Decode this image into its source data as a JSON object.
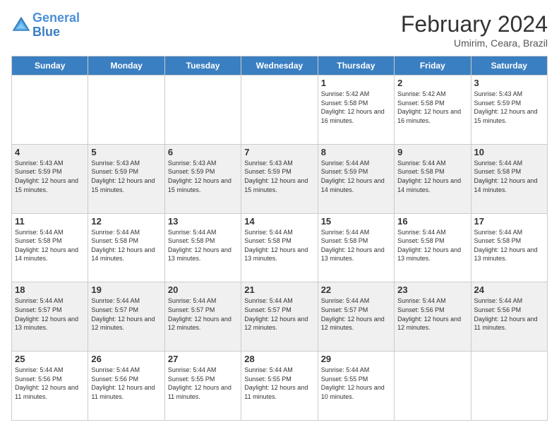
{
  "header": {
    "logo_line1": "General",
    "logo_line2": "Blue",
    "month_title": "February 2024",
    "location": "Umirim, Ceara, Brazil"
  },
  "days_of_week": [
    "Sunday",
    "Monday",
    "Tuesday",
    "Wednesday",
    "Thursday",
    "Friday",
    "Saturday"
  ],
  "weeks": [
    [
      {
        "day": "",
        "info": ""
      },
      {
        "day": "",
        "info": ""
      },
      {
        "day": "",
        "info": ""
      },
      {
        "day": "",
        "info": ""
      },
      {
        "day": "1",
        "info": "Sunrise: 5:42 AM\nSunset: 5:58 PM\nDaylight: 12 hours and 16 minutes."
      },
      {
        "day": "2",
        "info": "Sunrise: 5:42 AM\nSunset: 5:58 PM\nDaylight: 12 hours and 16 minutes."
      },
      {
        "day": "3",
        "info": "Sunrise: 5:43 AM\nSunset: 5:59 PM\nDaylight: 12 hours and 15 minutes."
      }
    ],
    [
      {
        "day": "4",
        "info": "Sunrise: 5:43 AM\nSunset: 5:59 PM\nDaylight: 12 hours and 15 minutes."
      },
      {
        "day": "5",
        "info": "Sunrise: 5:43 AM\nSunset: 5:59 PM\nDaylight: 12 hours and 15 minutes."
      },
      {
        "day": "6",
        "info": "Sunrise: 5:43 AM\nSunset: 5:59 PM\nDaylight: 12 hours and 15 minutes."
      },
      {
        "day": "7",
        "info": "Sunrise: 5:43 AM\nSunset: 5:59 PM\nDaylight: 12 hours and 15 minutes."
      },
      {
        "day": "8",
        "info": "Sunrise: 5:44 AM\nSunset: 5:59 PM\nDaylight: 12 hours and 14 minutes."
      },
      {
        "day": "9",
        "info": "Sunrise: 5:44 AM\nSunset: 5:58 PM\nDaylight: 12 hours and 14 minutes."
      },
      {
        "day": "10",
        "info": "Sunrise: 5:44 AM\nSunset: 5:58 PM\nDaylight: 12 hours and 14 minutes."
      }
    ],
    [
      {
        "day": "11",
        "info": "Sunrise: 5:44 AM\nSunset: 5:58 PM\nDaylight: 12 hours and 14 minutes."
      },
      {
        "day": "12",
        "info": "Sunrise: 5:44 AM\nSunset: 5:58 PM\nDaylight: 12 hours and 14 minutes."
      },
      {
        "day": "13",
        "info": "Sunrise: 5:44 AM\nSunset: 5:58 PM\nDaylight: 12 hours and 13 minutes."
      },
      {
        "day": "14",
        "info": "Sunrise: 5:44 AM\nSunset: 5:58 PM\nDaylight: 12 hours and 13 minutes."
      },
      {
        "day": "15",
        "info": "Sunrise: 5:44 AM\nSunset: 5:58 PM\nDaylight: 12 hours and 13 minutes."
      },
      {
        "day": "16",
        "info": "Sunrise: 5:44 AM\nSunset: 5:58 PM\nDaylight: 12 hours and 13 minutes."
      },
      {
        "day": "17",
        "info": "Sunrise: 5:44 AM\nSunset: 5:58 PM\nDaylight: 12 hours and 13 minutes."
      }
    ],
    [
      {
        "day": "18",
        "info": "Sunrise: 5:44 AM\nSunset: 5:57 PM\nDaylight: 12 hours and 13 minutes."
      },
      {
        "day": "19",
        "info": "Sunrise: 5:44 AM\nSunset: 5:57 PM\nDaylight: 12 hours and 12 minutes."
      },
      {
        "day": "20",
        "info": "Sunrise: 5:44 AM\nSunset: 5:57 PM\nDaylight: 12 hours and 12 minutes."
      },
      {
        "day": "21",
        "info": "Sunrise: 5:44 AM\nSunset: 5:57 PM\nDaylight: 12 hours and 12 minutes."
      },
      {
        "day": "22",
        "info": "Sunrise: 5:44 AM\nSunset: 5:57 PM\nDaylight: 12 hours and 12 minutes."
      },
      {
        "day": "23",
        "info": "Sunrise: 5:44 AM\nSunset: 5:56 PM\nDaylight: 12 hours and 12 minutes."
      },
      {
        "day": "24",
        "info": "Sunrise: 5:44 AM\nSunset: 5:56 PM\nDaylight: 12 hours and 11 minutes."
      }
    ],
    [
      {
        "day": "25",
        "info": "Sunrise: 5:44 AM\nSunset: 5:56 PM\nDaylight: 12 hours and 11 minutes."
      },
      {
        "day": "26",
        "info": "Sunrise: 5:44 AM\nSunset: 5:56 PM\nDaylight: 12 hours and 11 minutes."
      },
      {
        "day": "27",
        "info": "Sunrise: 5:44 AM\nSunset: 5:55 PM\nDaylight: 12 hours and 11 minutes."
      },
      {
        "day": "28",
        "info": "Sunrise: 5:44 AM\nSunset: 5:55 PM\nDaylight: 12 hours and 11 minutes."
      },
      {
        "day": "29",
        "info": "Sunrise: 5:44 AM\nSunset: 5:55 PM\nDaylight: 12 hours and 10 minutes."
      },
      {
        "day": "",
        "info": ""
      },
      {
        "day": "",
        "info": ""
      }
    ]
  ]
}
